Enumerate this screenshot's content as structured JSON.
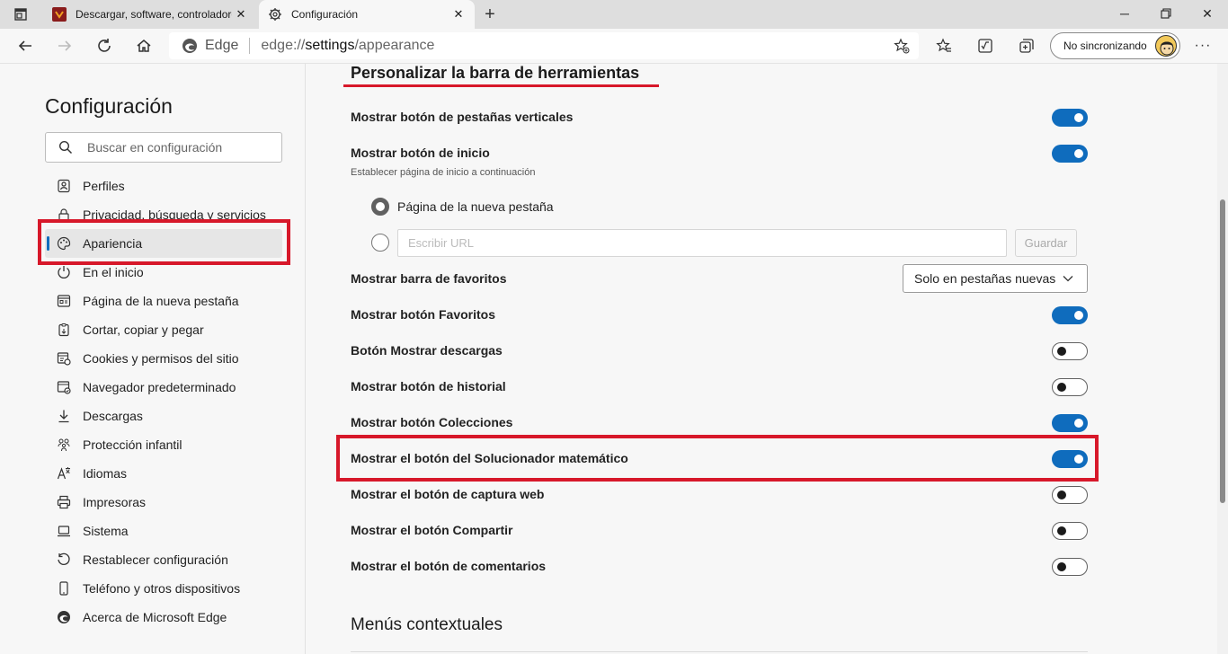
{
  "browser": {
    "tabs": [
      {
        "title": "Descargar, software, controladores, ...",
        "active": false
      },
      {
        "title": "Configuración",
        "active": true
      }
    ],
    "address": {
      "brand": "Edge",
      "url_prefix": "edge://",
      "url_bold": "settings",
      "url_suffix": "/appearance"
    },
    "profile_label": "No sincronizando"
  },
  "sidebar": {
    "title": "Configuración",
    "search_placeholder": "Buscar en configuración",
    "items": [
      {
        "label": "Perfiles",
        "icon": "profile-icon"
      },
      {
        "label": "Privacidad, búsqueda y servicios",
        "icon": "lock-icon"
      },
      {
        "label": "Apariencia",
        "icon": "palette-icon",
        "active": true
      },
      {
        "label": "En el inicio",
        "icon": "power-icon"
      },
      {
        "label": "Página de la nueva pestaña",
        "icon": "newtab-icon"
      },
      {
        "label": "Cortar, copiar y pegar",
        "icon": "clipboard-icon"
      },
      {
        "label": "Cookies y permisos del sitio",
        "icon": "cookie-icon"
      },
      {
        "label": "Navegador predeterminado",
        "icon": "browser-icon"
      },
      {
        "label": "Descargas",
        "icon": "download-icon"
      },
      {
        "label": "Protección infantil",
        "icon": "family-icon"
      },
      {
        "label": "Idiomas",
        "icon": "language-icon"
      },
      {
        "label": "Impresoras",
        "icon": "printer-icon"
      },
      {
        "label": "Sistema",
        "icon": "laptop-icon"
      },
      {
        "label": "Restablecer configuración",
        "icon": "reset-icon"
      },
      {
        "label": "Teléfono y otros dispositivos",
        "icon": "phone-icon"
      },
      {
        "label": "Acerca de Microsoft Edge",
        "icon": "edge-icon"
      }
    ]
  },
  "main": {
    "section_title": "Personalizar la barra de herramientas",
    "rows": {
      "vertical_tabs": {
        "label": "Mostrar botón de pestañas verticales",
        "on": true
      },
      "home": {
        "label": "Mostrar botón de inicio",
        "on": true,
        "sub": "Establecer página de inicio a continuación"
      },
      "favorites_bar": {
        "label": "Mostrar barra de favoritos",
        "value": "Solo en pestañas nuevas"
      },
      "favorites": {
        "label": "Mostrar botón Favoritos",
        "on": true
      },
      "downloads": {
        "label": "Botón Mostrar descargas",
        "on": false
      },
      "history": {
        "label": "Mostrar botón de historial",
        "on": false
      },
      "collections": {
        "label": "Mostrar botón Colecciones",
        "on": true
      },
      "math_solver": {
        "label": "Mostrar el botón del Solucionador matemático",
        "on": true
      },
      "web_capture": {
        "label": "Mostrar el botón de captura web",
        "on": false
      },
      "share": {
        "label": "Mostrar el botón Compartir",
        "on": false
      },
      "feedback": {
        "label": "Mostrar el botón de comentarios",
        "on": false
      }
    },
    "home_options": {
      "new_tab_label": "Página de la nueva pestaña",
      "url_placeholder": "Escribir URL",
      "save_label": "Guardar"
    },
    "next_section_title": "Menús contextuales"
  },
  "colors": {
    "accent": "#0f6cbd",
    "highlight": "#d7182a"
  }
}
